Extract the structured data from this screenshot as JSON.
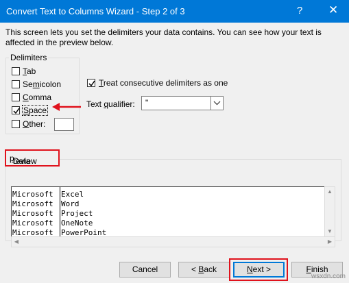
{
  "window": {
    "title": "Convert Text to Columns Wizard - Step 2 of 3",
    "help_glyph": "?",
    "close_glyph": "✕"
  },
  "description": "This screen lets you set the delimiters your data contains.  You can see how your text is affected in the preview below.",
  "delimiters": {
    "legend": "Delimiters",
    "items": [
      {
        "label_pre": "",
        "accel": "T",
        "label_post": "ab",
        "checked": false
      },
      {
        "label_pre": "Se",
        "accel": "m",
        "label_post": "icolon",
        "checked": false
      },
      {
        "label_pre": "",
        "accel": "C",
        "label_post": "omma",
        "checked": false
      },
      {
        "label_pre": "",
        "accel": "S",
        "label_post": "pace",
        "checked": true
      },
      {
        "label_pre": "",
        "accel": "O",
        "label_post": "ther:",
        "checked": false
      }
    ],
    "other_value": ""
  },
  "options": {
    "consecutive_pre": "",
    "consecutive_accel": "T",
    "consecutive_post": "reat consecutive delimiters as one",
    "consecutive_checked": true,
    "qualifier_pre": "Text ",
    "qualifier_accel": "q",
    "qualifier_post": "ualifier:",
    "qualifier_value": "\""
  },
  "preview": {
    "label_pre": "Data ",
    "label_accel": "p",
    "label_post": "review",
    "rows": [
      [
        "Microsoft",
        "Excel"
      ],
      [
        "Microsoft",
        "Word"
      ],
      [
        "Microsoft",
        "Project"
      ],
      [
        "Microsoft",
        "OneNote"
      ],
      [
        "Microsoft",
        "PowerPoint"
      ]
    ]
  },
  "buttons": {
    "cancel": "Cancel",
    "back_pre": "< ",
    "back_accel": "B",
    "back_post": "ack",
    "next_pre": "",
    "next_accel": "N",
    "next_post": "ext >",
    "finish_pre": "",
    "finish_accel": "F",
    "finish_post": "inish"
  },
  "watermark": "wsxdn.com",
  "colors": {
    "titlebar": "#0078d7",
    "annotation": "#e0121c"
  }
}
